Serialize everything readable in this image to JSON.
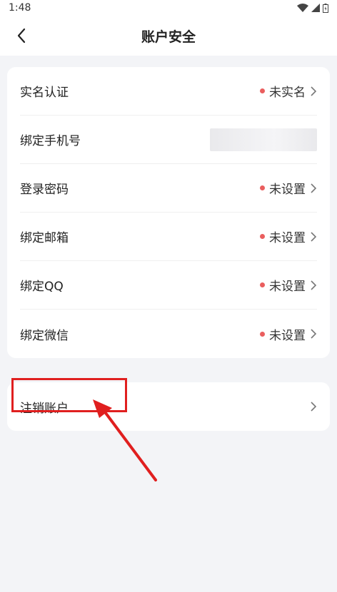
{
  "status": {
    "time": "1:48"
  },
  "header": {
    "title": "账户安全"
  },
  "security_items": [
    {
      "label": "实名认证",
      "value": "未实名",
      "dot": true
    },
    {
      "label": "绑定手机号",
      "value": "",
      "dot": false,
      "masked": true
    },
    {
      "label": "登录密码",
      "value": "未设置",
      "dot": true
    },
    {
      "label": "绑定邮箱",
      "value": "未设置",
      "dot": true
    },
    {
      "label": "绑定QQ",
      "value": "未设置",
      "dot": true
    },
    {
      "label": "绑定微信",
      "value": "未设置",
      "dot": true
    }
  ],
  "account": {
    "cancel_label": "注销账户"
  },
  "colors": {
    "dot": "#ea5e5e",
    "annotation": "#e01f1f"
  }
}
